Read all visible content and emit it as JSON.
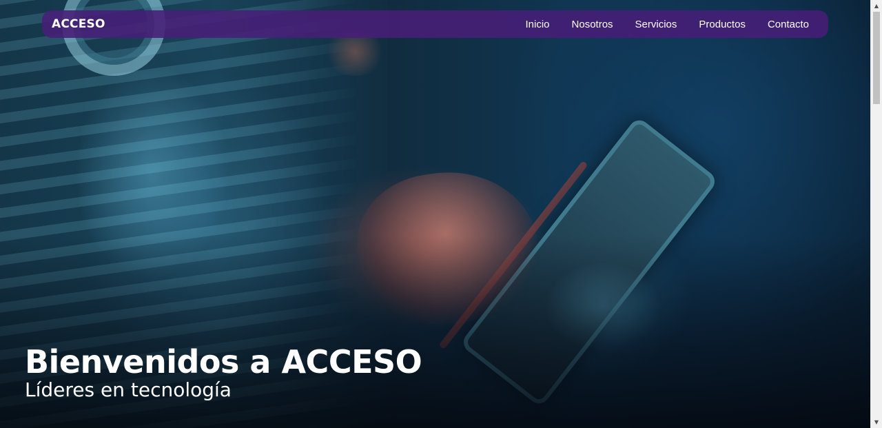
{
  "navbar": {
    "brand": "ACCESO",
    "links": [
      "Inicio",
      "Nosotros",
      "Servicios",
      "Productos",
      "Contacto"
    ]
  },
  "hero": {
    "title": "Bienvenidos a ACCESO",
    "subtitle": "Líderes en tecnología"
  },
  "colors": {
    "navbar_bg": "#481e78",
    "text": "#ffffff"
  },
  "icons": {
    "scroll_up": "triangle-up-icon",
    "scroll_down": "triangle-down-icon"
  }
}
